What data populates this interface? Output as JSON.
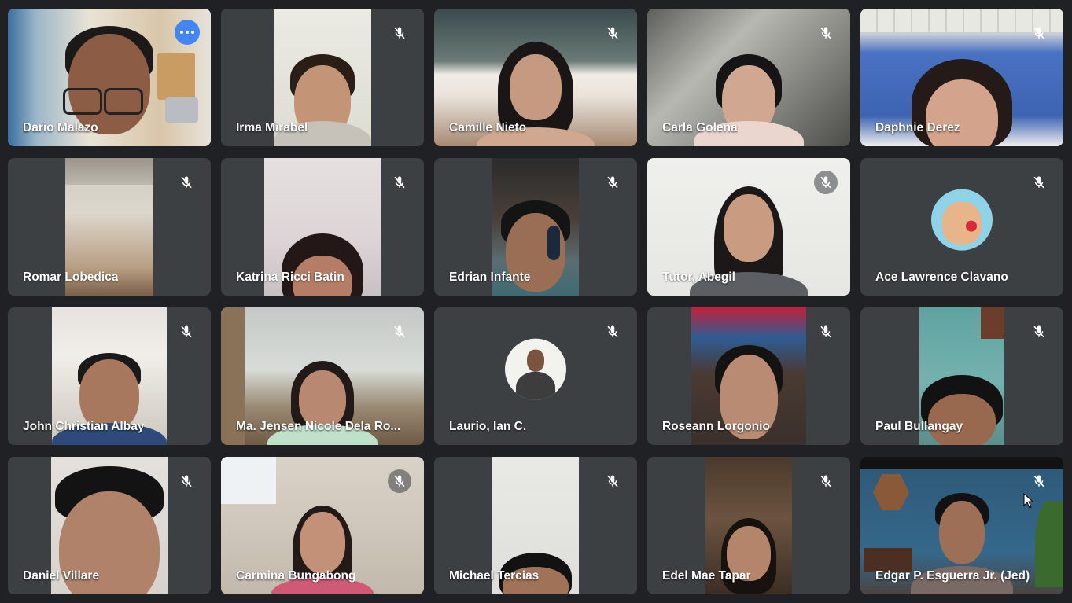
{
  "meeting": {
    "participants": [
      {
        "name": "Dario Malazo",
        "muted": false,
        "active": true
      },
      {
        "name": "Irma Mirabel",
        "muted": true
      },
      {
        "name": "Camille Nieto",
        "muted": true
      },
      {
        "name": "Carla Golena",
        "muted": true
      },
      {
        "name": "Daphnie Derez",
        "muted": true
      },
      {
        "name": "Romar Lobedica",
        "muted": true
      },
      {
        "name": "Katrina Ricci Batin",
        "muted": true
      },
      {
        "name": "Edrian Infante",
        "muted": true
      },
      {
        "name": "Tutor, Abegil",
        "muted": true
      },
      {
        "name": "Ace Lawrence Clavano",
        "muted": true,
        "avatar": true
      },
      {
        "name": "John Christian Albay",
        "muted": true
      },
      {
        "name": "Ma. Jensen Nicole Dela Ro...",
        "muted": true
      },
      {
        "name": "Laurio, Ian C.",
        "muted": true,
        "avatar": true
      },
      {
        "name": "Roseann Lorgonio",
        "muted": true
      },
      {
        "name": "Paul Bullangay",
        "muted": true
      },
      {
        "name": "Daniel Villare",
        "muted": true
      },
      {
        "name": "Carmina Bungabong",
        "muted": true
      },
      {
        "name": "Michael Tercias",
        "muted": true
      },
      {
        "name": "Edel Mae Tapar",
        "muted": true
      },
      {
        "name": "Edgar P. Esguerra Jr. (Jed)",
        "muted": true
      }
    ]
  },
  "icons": {
    "muted": "mic-off-icon",
    "more": "more-options-icon",
    "cursor": "mouse-pointer-icon"
  },
  "colors": {
    "background": "#202124",
    "tile": "#3c4043",
    "active_border": "#8ab4f8",
    "more_button": "#4285f4"
  }
}
